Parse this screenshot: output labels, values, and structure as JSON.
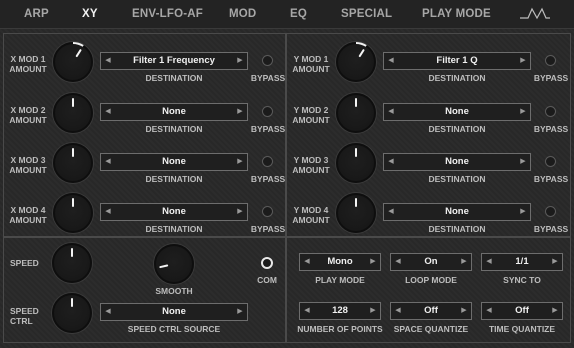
{
  "tabs": [
    "ARP",
    "XY",
    "ENV-LFO-AF",
    "MOD",
    "EQ",
    "SPECIAL",
    "PLAY MODE"
  ],
  "active_tab": "XY",
  "icons": {
    "lfo_wave": "lfo-wave-icon"
  },
  "x_mods": [
    {
      "label_1": "X MOD 1",
      "label_2": "AMOUNT",
      "destination": "Filter 1 Frequency",
      "dest_label": "DESTINATION",
      "bypass": "BYPASS",
      "amount": 0.62
    },
    {
      "label_1": "X MOD 2",
      "label_2": "AMOUNT",
      "destination": "None",
      "dest_label": "DESTINATION",
      "bypass": "BYPASS",
      "amount": 0.5
    },
    {
      "label_1": "X MOD 3",
      "label_2": "AMOUNT",
      "destination": "None",
      "dest_label": "DESTINATION",
      "bypass": "BYPASS",
      "amount": 0.5
    },
    {
      "label_1": "X MOD 4",
      "label_2": "AMOUNT",
      "destination": "None",
      "dest_label": "DESTINATION",
      "bypass": "BYPASS",
      "amount": 0.5
    }
  ],
  "y_mods": [
    {
      "label_1": "Y MOD 1",
      "label_2": "AMOUNT",
      "destination": "Filter 1 Q",
      "dest_label": "DESTINATION",
      "bypass": "BYPASS",
      "amount": 0.62
    },
    {
      "label_1": "Y MOD 2",
      "label_2": "AMOUNT",
      "destination": "None",
      "dest_label": "DESTINATION",
      "bypass": "BYPASS",
      "amount": 0.5
    },
    {
      "label_1": "Y MOD 3",
      "label_2": "AMOUNT",
      "destination": "None",
      "dest_label": "DESTINATION",
      "bypass": "BYPASS",
      "amount": 0.5
    },
    {
      "label_1": "Y MOD 4",
      "label_2": "AMOUNT",
      "destination": "None",
      "dest_label": "DESTINATION",
      "bypass": "BYPASS",
      "amount": 0.5
    }
  ],
  "speed": {
    "label": "SPEED",
    "value": 0.5
  },
  "smooth": {
    "label": "SMOOTH",
    "value": 0.12
  },
  "com": {
    "label": "COM"
  },
  "speed_ctrl": {
    "label_1": "SPEED",
    "label_2": "CTRL",
    "value": 0.5,
    "source": "None",
    "source_label": "SPEED CTRL SOURCE"
  },
  "play_mode": {
    "value": "Mono",
    "label": "PLAY MODE"
  },
  "loop_mode": {
    "value": "On",
    "label": "LOOP MODE"
  },
  "sync_to": {
    "value": "1/1",
    "label": "SYNC TO"
  },
  "number_of_points": {
    "value": "128",
    "label": "NUMBER OF POINTS"
  },
  "space_quantize": {
    "value": "Off",
    "label": "SPACE QUANTIZE"
  },
  "time_quantize": {
    "value": "Off",
    "label": "TIME QUANTIZE"
  }
}
